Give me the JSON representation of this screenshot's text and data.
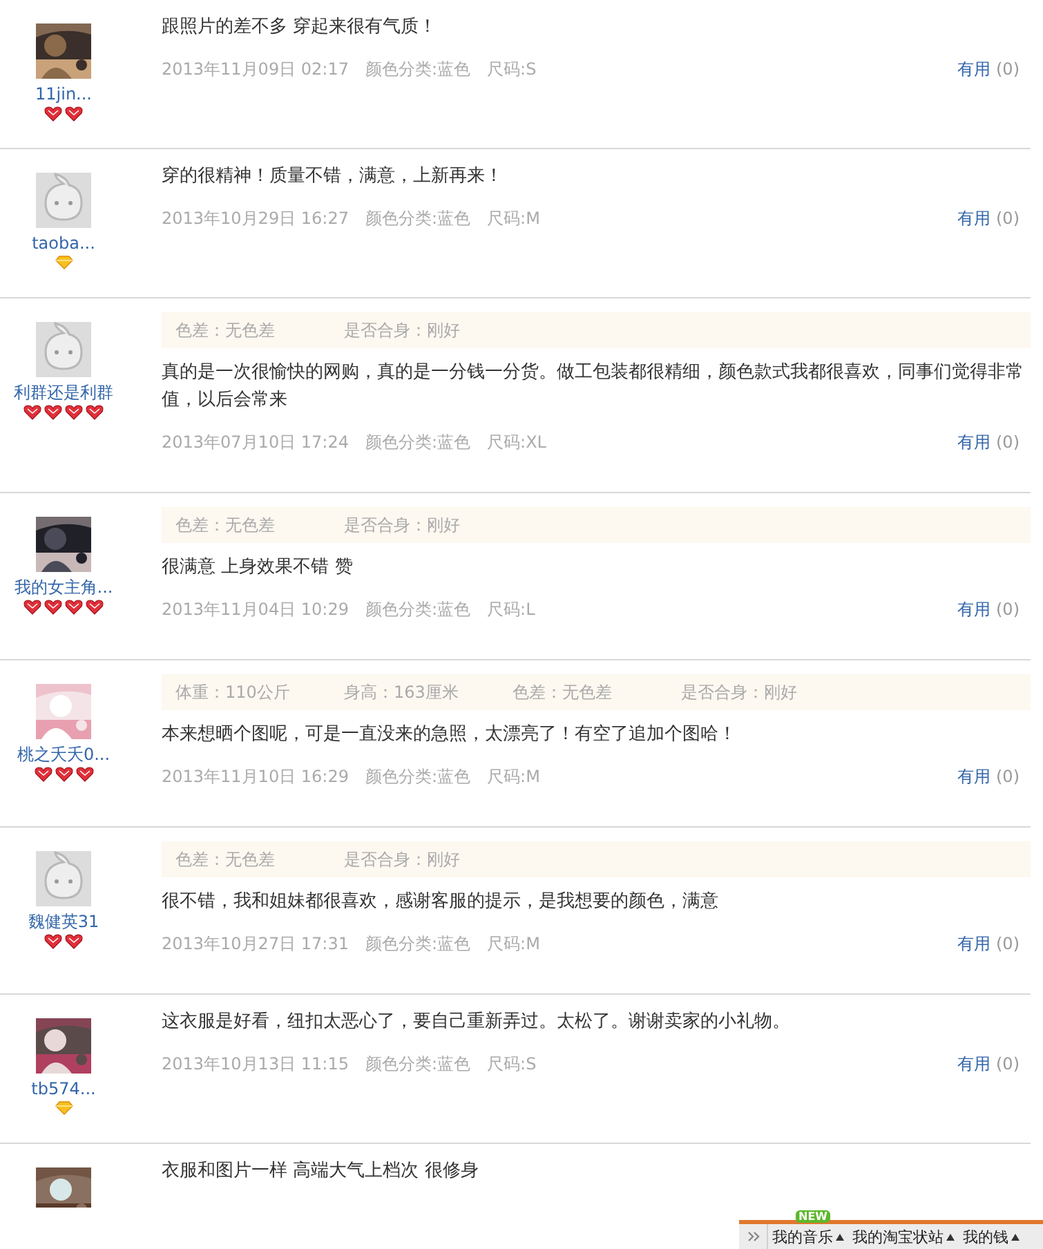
{
  "reviews": [
    {
      "user": {
        "name": "11jin...",
        "credit": [
          {
            "kind": "heart"
          },
          {
            "kind": "heart"
          }
        ]
      },
      "comment": "跟照片的差不多 穿起来很有气质！",
      "date": "2013年11月09日 02:17",
      "variant": "颜色分类:蓝色",
      "size": "尺码:S",
      "useful": {
        "label": "有用",
        "count": "(0)"
      }
    },
    {
      "user": {
        "name": "taoba...",
        "avatar": {
          "kind": "default"
        },
        "credit": [
          {
            "kind": "diamond"
          }
        ]
      },
      "comment": "穿的很精神！质量不错，满意，上新再来！",
      "date": "2013年10月29日 16:27",
      "variant": "颜色分类:蓝色",
      "size": "尺码:M",
      "useful": {
        "label": "有用",
        "count": "(0)"
      }
    },
    {
      "user": {
        "name": "利群还是利群",
        "avatar": {
          "kind": "default"
        },
        "credit": [
          {
            "kind": "heart"
          },
          {
            "kind": "heart"
          },
          {
            "kind": "heart"
          },
          {
            "kind": "heart"
          }
        ]
      },
      "tags": [
        "色差：无色差",
        "是否合身：刚好"
      ],
      "comment": "真的是一次很愉快的网购，真的是一分钱一分货。做工包装都很精细，颜色款式我都很喜欢，同事们觉得非常值，以后会常来",
      "date": "2013年07月10日 17:24",
      "variant": "颜色分类:蓝色",
      "size": "尺码:XL",
      "useful": {
        "label": "有用",
        "count": "(0)"
      }
    },
    {
      "user": {
        "name": "我的女主角...",
        "credit": [
          {
            "kind": "heart"
          },
          {
            "kind": "heart"
          },
          {
            "kind": "heart"
          },
          {
            "kind": "heart"
          }
        ]
      },
      "tags": [
        "色差：无色差",
        "是否合身：刚好"
      ],
      "comment": "很满意 上身效果不错 赞",
      "date": "2013年11月04日 10:29",
      "variant": "颜色分类:蓝色",
      "size": "尺码:L",
      "useful": {
        "label": "有用",
        "count": "(0)"
      }
    },
    {
      "user": {
        "name": "桃之夭夭0...",
        "credit": [
          {
            "kind": "heart"
          },
          {
            "kind": "heart"
          },
          {
            "kind": "heart"
          }
        ]
      },
      "tags": [
        "体重：110公斤",
        "身高：163厘米",
        "色差：无色差",
        "是否合身：刚好"
      ],
      "comment": "本来想晒个图呢，可是一直没来的急照，太漂亮了！有空了追加个图哈！",
      "date": "2013年11月10日 16:29",
      "variant": "颜色分类:蓝色",
      "size": "尺码:M",
      "useful": {
        "label": "有用",
        "count": "(0)"
      }
    },
    {
      "user": {
        "name": "魏健英31",
        "avatar": {
          "kind": "default"
        },
        "credit": [
          {
            "kind": "heart"
          },
          {
            "kind": "heart"
          }
        ]
      },
      "tags": [
        "色差：无色差",
        "是否合身：刚好"
      ],
      "comment": "很不错，我和姐妹都很喜欢，感谢客服的提示，是我想要的颜色，满意",
      "date": "2013年10月27日 17:31",
      "variant": "颜色分类:蓝色",
      "size": "尺码:M",
      "useful": {
        "label": "有用",
        "count": "(0)"
      }
    },
    {
      "user": {
        "name": "tb574...",
        "credit": [
          {
            "kind": "diamond"
          }
        ]
      },
      "comment": "这衣服是好看，纽扣太恶心了，要自己重新弄过。太松了。谢谢卖家的小礼物。",
      "date": "2013年10月13日 11:15",
      "variant": "颜色分类:蓝色",
      "size": "尺码:S",
      "useful": {
        "label": "有用",
        "count": "(0)"
      }
    },
    {
      "comment": "衣服和图片一样 高端大气上档次 很修身"
    }
  ],
  "toolbar": {
    "items": [
      {
        "label": "我的音乐",
        "badge": "NEW"
      },
      {
        "label": "我的淘宝状站"
      },
      {
        "label": "我的钱"
      }
    ]
  }
}
